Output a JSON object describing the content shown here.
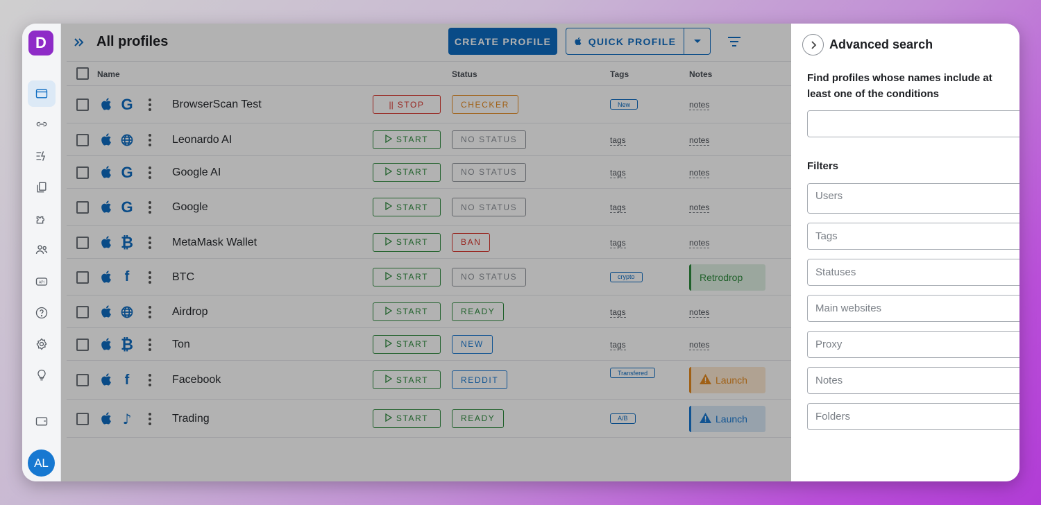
{
  "app": {
    "logo_letter": "D",
    "avatar_initials": "AL"
  },
  "header": {
    "title": "All profiles",
    "create_button": "CREATE PROFILE",
    "quick_button": "QUICK PROFILE"
  },
  "table": {
    "columns": {
      "name": "Name",
      "status": "Status",
      "tags": "Tags",
      "notes": "Notes"
    },
    "rows": [
      {
        "name": "BrowserScan Test",
        "browser_icon": "google-icon",
        "action": "STOP",
        "action_type": "stop",
        "status": "CHECKER",
        "status_color": "#e58a1f",
        "tag": "New",
        "tag_type": "chip",
        "note": "notes",
        "note_type": "link"
      },
      {
        "name": "Leonardo AI",
        "browser_icon": "globe-icon",
        "action": "START",
        "action_type": "start",
        "status": "NO STATUS",
        "status_color": "#8a8f96",
        "tag": "tags",
        "tag_type": "link",
        "note": "notes",
        "note_type": "link"
      },
      {
        "name": "Google AI",
        "browser_icon": "google-icon",
        "action": "START",
        "action_type": "start",
        "status": "NO STATUS",
        "status_color": "#8a8f96",
        "tag": "tags",
        "tag_type": "link",
        "note": "notes",
        "note_type": "link"
      },
      {
        "name": "Google",
        "browser_icon": "google-icon",
        "action": "START",
        "action_type": "start",
        "status": "NO STATUS",
        "status_color": "#8a8f96",
        "tag": "tags",
        "tag_type": "link",
        "note": "notes",
        "note_type": "link"
      },
      {
        "name": "MetaMask Wallet",
        "browser_icon": "bitcoin-icon",
        "action": "START",
        "action_type": "start",
        "status": "BAN",
        "status_color": "#d8342c",
        "tag": "tags",
        "tag_type": "link",
        "note": "notes",
        "note_type": "link"
      },
      {
        "name": "BTC",
        "browser_icon": "facebook-icon",
        "action": "START",
        "action_type": "start",
        "status": "NO STATUS",
        "status_color": "#8a8f96",
        "tag": "crypto",
        "tag_type": "chip",
        "note": "Retrodrop",
        "note_type": "green"
      },
      {
        "name": "Airdrop",
        "browser_icon": "globe-icon",
        "action": "START",
        "action_type": "start",
        "status": "READY",
        "status_color": "#2e8b3e",
        "tag": "tags",
        "tag_type": "link",
        "note": "notes",
        "note_type": "link"
      },
      {
        "name": "Ton",
        "browser_icon": "bitcoin-icon",
        "action": "START",
        "action_type": "start",
        "status": "NEW",
        "status_color": "#1778d1",
        "tag": "tags",
        "tag_type": "link",
        "note": "notes",
        "note_type": "link"
      },
      {
        "name": "Facebook",
        "browser_icon": "facebook-icon",
        "action": "START",
        "action_type": "start",
        "status": "REDDIT",
        "status_color": "#1778d1",
        "tag": "Transfered",
        "tag_type": "chip",
        "note": "Launch",
        "note_type": "warning"
      },
      {
        "name": "Trading",
        "browser_icon": "tiktok-icon",
        "action": "START",
        "action_type": "start",
        "status": "READY",
        "status_color": "#2e8b3e",
        "tag": "A/B",
        "tag_type": "chip",
        "note": "Launch",
        "note_type": "info"
      }
    ]
  },
  "panel": {
    "title": "Advanced search",
    "description": "Find profiles whose names include at least one of the conditions",
    "filters_label": "Filters",
    "fields": [
      {
        "label": "Users",
        "dropdown": true
      },
      {
        "label": "Tags",
        "dropdown": true
      },
      {
        "label": "Statuses",
        "dropdown": true
      },
      {
        "label": "Main websites",
        "dropdown": true
      },
      {
        "label": "Proxy",
        "dropdown": true
      },
      {
        "label": "Notes",
        "dropdown": false
      },
      {
        "label": "Folders",
        "dropdown": true
      }
    ]
  },
  "colors": {
    "accent": "#0d6cc2",
    "start": "#2e8b3e",
    "stop": "#d8342c",
    "logo": "#8e2bc7"
  }
}
